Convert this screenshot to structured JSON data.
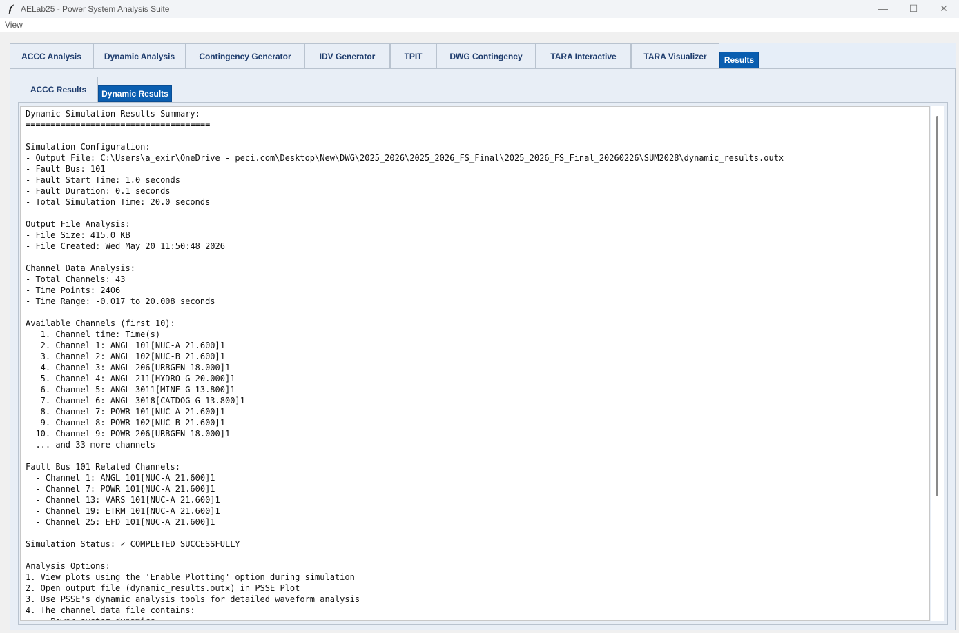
{
  "window": {
    "title": "AELab25 - Power System Analysis Suite",
    "icon": "feather-icon",
    "controls": {
      "minimize": "—",
      "maximize": "☐",
      "close": "✕"
    }
  },
  "menubar": {
    "items": [
      "View"
    ]
  },
  "main_tabs": [
    {
      "label": "ACCC Analysis",
      "active": false
    },
    {
      "label": "Dynamic Analysis",
      "active": false
    },
    {
      "label": "Contingency Generator",
      "active": false
    },
    {
      "label": "IDV Generator",
      "active": false
    },
    {
      "label": "TPIT",
      "active": false
    },
    {
      "label": "DWG Contingency",
      "active": false
    },
    {
      "label": "TARA Interactive",
      "active": false
    },
    {
      "label": "TARA Visualizer",
      "active": false
    },
    {
      "label": "Results",
      "active": true
    }
  ],
  "results_tabs": [
    {
      "label": "ACCC Results",
      "active": false
    },
    {
      "label": "Dynamic Results",
      "active": true
    }
  ],
  "results_text": [
    "Dynamic Simulation Results Summary:",
    "=====================================",
    "",
    "Simulation Configuration:",
    "- Output File: C:\\Users\\a_exir\\OneDrive - peci.com\\Desktop\\New\\DWG\\2025_2026\\2025_2026_FS_Final\\2025_2026_FS_Final_20260226\\SUM2028\\dynamic_results.outx",
    "- Fault Bus: 101",
    "- Fault Start Time: 1.0 seconds",
    "- Fault Duration: 0.1 seconds",
    "- Total Simulation Time: 20.0 seconds",
    "",
    "Output File Analysis:",
    "- File Size: 415.0 KB",
    "- File Created: Wed May 20 11:50:48 2026",
    "",
    "Channel Data Analysis:",
    "- Total Channels: 43",
    "- Time Points: 2406",
    "- Time Range: -0.017 to 20.008 seconds",
    "",
    "Available Channels (first 10):",
    "   1. Channel time: Time(s)",
    "   2. Channel 1: ANGL 101[NUC-A 21.600]1",
    "   3. Channel 2: ANGL 102[NUC-B 21.600]1",
    "   4. Channel 3: ANGL 206[URBGEN 18.000]1",
    "   5. Channel 4: ANGL 211[HYDRO_G 20.000]1",
    "   6. Channel 5: ANGL 3011[MINE_G 13.800]1",
    "   7. Channel 6: ANGL 3018[CATDOG_G 13.800]1",
    "   8. Channel 7: POWR 101[NUC-A 21.600]1",
    "   9. Channel 8: POWR 102[NUC-B 21.600]1",
    "  10. Channel 9: POWR 206[URBGEN 18.000]1",
    "  ... and 33 more channels",
    "",
    "Fault Bus 101 Related Channels:",
    "  - Channel 1: ANGL 101[NUC-A 21.600]1",
    "  - Channel 7: POWR 101[NUC-A 21.600]1",
    "  - Channel 13: VARS 101[NUC-A 21.600]1",
    "  - Channel 19: ETRM 101[NUC-A 21.600]1",
    "  - Channel 25: EFD 101[NUC-A 21.600]1",
    "",
    "Simulation Status: ✓ COMPLETED SUCCESSFULLY",
    "",
    "Analysis Options:",
    "1. View plots using the 'Enable Plotting' option during simulation",
    "2. Open output file (dynamic_results.outx) in PSSE Plot",
    "3. Use PSSE's dynamic analysis tools for detailed waveform analysis",
    "4. The channel data file contains:",
    "   - Power system dynamics"
  ]
}
